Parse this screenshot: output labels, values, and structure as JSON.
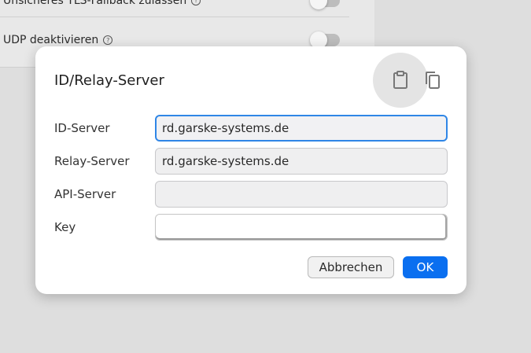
{
  "background": {
    "settings": [
      {
        "label": "Unsicheres TLS-Fallback zulassen",
        "help_icon": "help-circle-icon",
        "enabled": false
      },
      {
        "label": "UDP deaktivieren",
        "help_icon": "help-circle-icon",
        "enabled": false
      }
    ]
  },
  "dialog": {
    "title": "ID/Relay-Server",
    "paste_icon": "clipboard-paste-icon",
    "copy_icon": "copy-icon",
    "fields": {
      "id_server": {
        "label": "ID-Server",
        "value": "rd.garske-systems.de"
      },
      "relay_server": {
        "label": "Relay-Server",
        "value": "rd.garske-systems.de"
      },
      "api_server": {
        "label": "API-Server",
        "value": ""
      },
      "key": {
        "label": "Key",
        "value": ""
      }
    },
    "buttons": {
      "cancel": "Abbrechen",
      "ok": "OK"
    }
  },
  "colors": {
    "accent": "#0a6ff0",
    "focus_border": "#2f86e6",
    "backdrop": "#dedede"
  }
}
